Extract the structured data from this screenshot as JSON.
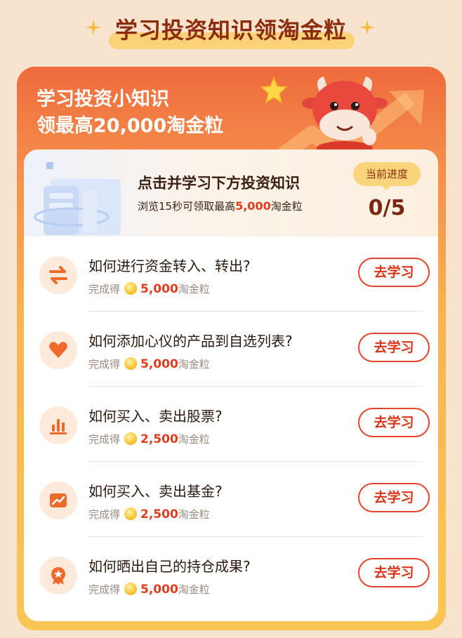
{
  "page_title": "学习投资知识领淘金粒",
  "hero": {
    "line1": "学习投资小知识",
    "line2": "领最高20,000淘金粒"
  },
  "progress": {
    "title": "点击并学习下方投资知识",
    "sub_prefix": "浏览15秒可领取最高",
    "sub_amount": "5,000",
    "sub_suffix": "淘金粒",
    "badge": "当前进度",
    "value": "0/5"
  },
  "tasks": [
    {
      "question": "如何进行资金转入、转出?",
      "reward_prefix": "完成得",
      "amount": "5,000",
      "unit": "淘金粒",
      "button": "去学习",
      "icon": "transfer-arrows-icon"
    },
    {
      "question": "如何添加心仪的产品到自选列表?",
      "reward_prefix": "完成得",
      "amount": "5,000",
      "unit": "淘金粒",
      "button": "去学习",
      "icon": "heart-icon"
    },
    {
      "question": "如何买入、卖出股票?",
      "reward_prefix": "完成得",
      "amount": "2,500",
      "unit": "淘金粒",
      "button": "去学习",
      "icon": "bar-chart-icon"
    },
    {
      "question": "如何买入、卖出基金?",
      "reward_prefix": "完成得",
      "amount": "2,500",
      "unit": "淘金粒",
      "button": "去学习",
      "icon": "trend-chart-icon"
    },
    {
      "question": "如何晒出自己的持仓成果?",
      "reward_prefix": "完成得",
      "amount": "5,000",
      "unit": "淘金粒",
      "button": "去学习",
      "icon": "award-badge-icon"
    }
  ],
  "colors": {
    "accent": "#e23c1c",
    "title": "#8b2c0c",
    "gradient_top": "#ee6b3d",
    "gradient_bottom": "#f9c654"
  }
}
